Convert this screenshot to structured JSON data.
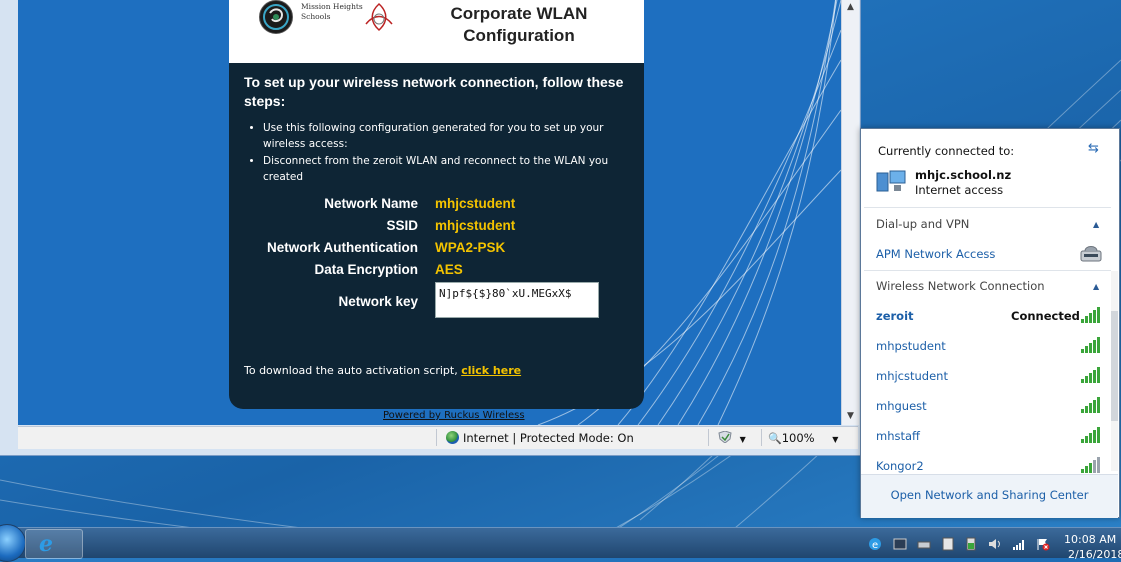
{
  "portal": {
    "logo_text_line1": "Mission Heights",
    "logo_text_line2": "Schools",
    "title_line1": "Corporate WLAN",
    "title_line2": "Configuration",
    "intro": "To set up your wireless network connection, follow these steps:",
    "steps": [
      "Use this following configuration generated for you to set up your wireless access:",
      "Disconnect from the zeroit WLAN and reconnect to the WLAN you created"
    ],
    "config": [
      {
        "label": "Network Name",
        "value": "mhjcstudent"
      },
      {
        "label": "SSID",
        "value": "mhjcstudent"
      },
      {
        "label": "Network Authentication",
        "value": "WPA2-PSK"
      },
      {
        "label": "Data Encryption",
        "value": "AES"
      }
    ],
    "network_key_label": "Network key",
    "network_key_value": "N]pf${$}80`xU.MEGxX$",
    "download_text": "To download the auto activation script, ",
    "download_link": "click here",
    "powered_by": "Powered by Ruckus Wireless"
  },
  "ie_status": {
    "zone": "Internet | Protected Mode: On",
    "zoom": "100%",
    "zoom_icon": "magnifier-icon",
    "security_icon": "security-shield-icon"
  },
  "flyout": {
    "header": "Currently connected to:",
    "connection_name": "mhjc.school.nz",
    "connection_status": "Internet access",
    "dialup_section": "Dial-up and VPN",
    "dialup_item": "APM Network Access",
    "wireless_section": "Wireless Network Connection",
    "networks": [
      {
        "name": "zeroit",
        "status": "Connected",
        "bars": 5
      },
      {
        "name": "mhpstudent",
        "status": "",
        "bars": 5
      },
      {
        "name": "mhjcstudent",
        "status": "",
        "bars": 5
      },
      {
        "name": "mhguest",
        "status": "",
        "bars": 5
      },
      {
        "name": "mhstaff",
        "status": "",
        "bars": 5
      },
      {
        "name": "Kongor2",
        "status": "",
        "bars": 3
      }
    ],
    "footer_link": "Open Network and Sharing Center",
    "colors": {
      "link": "#1c5fa8",
      "signal": "#3aa53a"
    }
  },
  "taskbar": {
    "clock_time": "10:08 AM",
    "clock_date": "2/16/2018",
    "pinned_app_icon": "internet-explorer-icon"
  }
}
